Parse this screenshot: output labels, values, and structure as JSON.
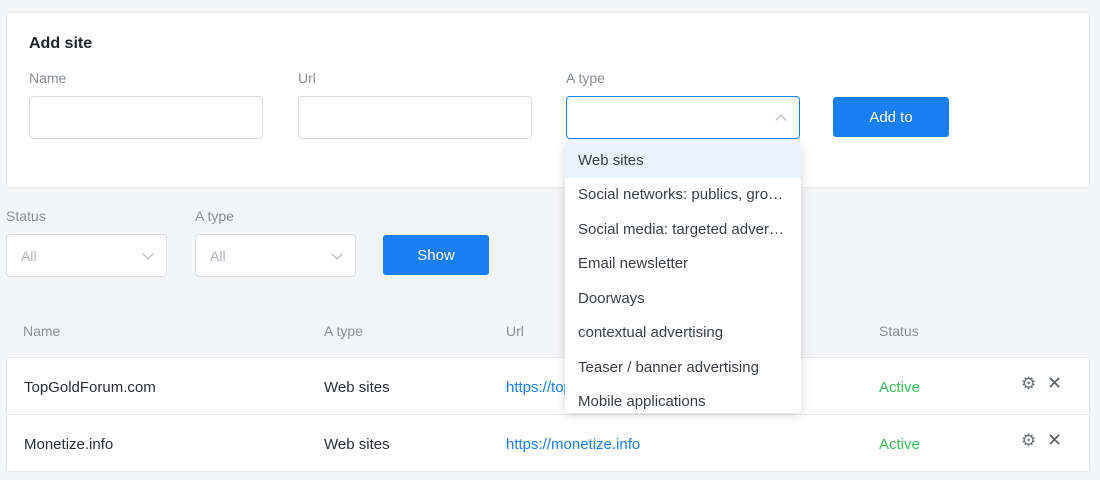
{
  "add_site": {
    "title": "Add site",
    "name_label": "Name",
    "name_value": "",
    "url_label": "Url",
    "url_value": "",
    "type_label": "A type",
    "type_value": "",
    "add_button": "Add to"
  },
  "type_dropdown": {
    "options": [
      "Web sites",
      "Social networks: publics, groups",
      "Social media: targeted advertising",
      "Email newsletter",
      "Doorways",
      "contextual advertising",
      "Teaser / banner advertising",
      "Mobile applications"
    ],
    "highlighted_index": 0
  },
  "filters": {
    "status_label": "Status",
    "status_value": "All",
    "type_label": "A type",
    "type_value": "All",
    "show_button": "Show"
  },
  "table": {
    "headers": {
      "name": "Name",
      "type": "A type",
      "url": "Url",
      "status": "Status"
    },
    "rows": [
      {
        "name": "TopGoldForum.com",
        "type": "Web sites",
        "url": "https://topgoldforum.com",
        "status": "Active"
      },
      {
        "name": "Monetize.info",
        "type": "Web sites",
        "url": "https://monetize.info",
        "status": "Active"
      }
    ]
  },
  "colors": {
    "accent": "#1a7ef7",
    "status_active": "#3dbb5b",
    "link": "#1c7ef5"
  },
  "icons": {
    "settings": "gear-icon",
    "delete": "close-icon",
    "dropdown": "chevron-down-icon"
  }
}
